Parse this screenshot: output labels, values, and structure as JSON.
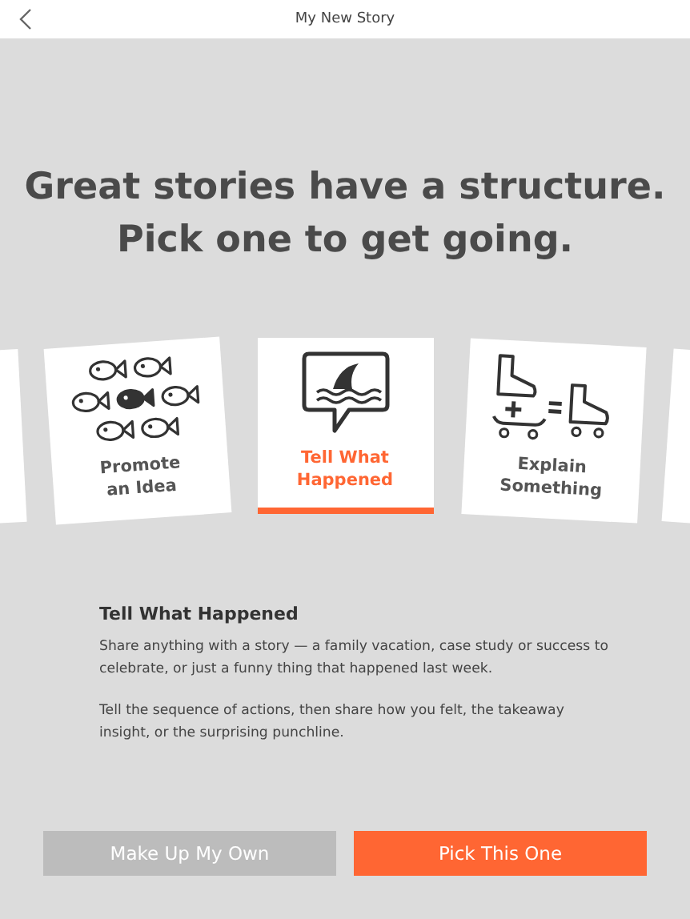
{
  "header": {
    "title": "My New Story"
  },
  "heading": [
    "Great stories have a structure.",
    "Pick one to get going."
  ],
  "cards": [
    {
      "kind": "fish",
      "label": [
        "Promote",
        "an Idea"
      ],
      "selected": false
    },
    {
      "kind": "shark",
      "label": [
        "Tell What",
        "Happened"
      ],
      "selected": true
    },
    {
      "kind": "skates",
      "label": [
        "Explain",
        "Something"
      ],
      "selected": false
    }
  ],
  "description": {
    "title": "Tell What Happened",
    "paragraphs": [
      "Share anything with a story — a family vacation, case study or success to celebrate, or just a funny thing that happened last week.",
      "Tell the sequence of actions, then share how you felt, the takeaway insight, or the surprising punchline."
    ]
  },
  "buttons": [
    {
      "kind": "secondary",
      "label": "Make Up My Own"
    },
    {
      "kind": "primary",
      "label": "Pick This One"
    }
  ]
}
